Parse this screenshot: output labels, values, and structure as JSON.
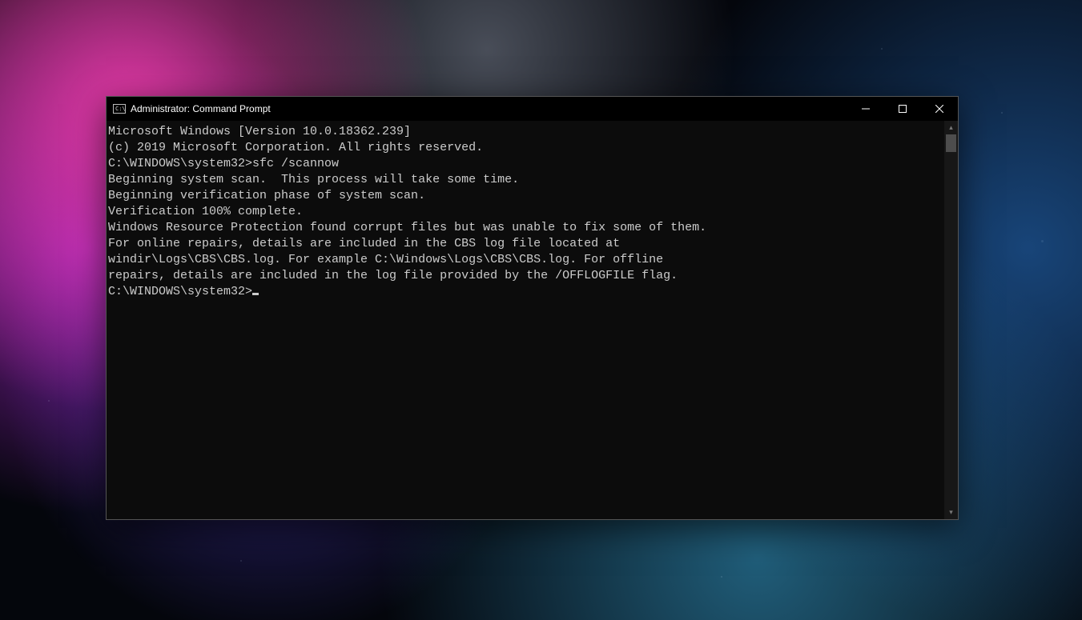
{
  "window": {
    "title": "Administrator: Command Prompt"
  },
  "console": {
    "lines": [
      "Microsoft Windows [Version 10.0.18362.239]",
      "(c) 2019 Microsoft Corporation. All rights reserved.",
      "",
      "C:\\WINDOWS\\system32>sfc /scannow",
      "",
      "Beginning system scan.  This process will take some time.",
      "",
      "Beginning verification phase of system scan.",
      "Verification 100% complete.",
      "",
      "Windows Resource Protection found corrupt files but was unable to fix some of them.",
      "For online repairs, details are included in the CBS log file located at",
      "windir\\Logs\\CBS\\CBS.log. For example C:\\Windows\\Logs\\CBS\\CBS.log. For offline",
      "repairs, details are included in the log file provided by the /OFFLOGFILE flag.",
      "",
      "C:\\WINDOWS\\system32>"
    ]
  }
}
